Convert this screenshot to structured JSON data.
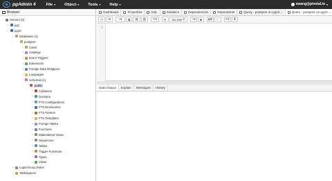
{
  "app": {
    "brand": "pgAdmin 4",
    "user": "swang@pivotal.io"
  },
  "menu": [
    {
      "label": "File"
    },
    {
      "label": "Object"
    },
    {
      "label": "Tools"
    },
    {
      "label": "Help"
    }
  ],
  "browser": {
    "title": "Browser",
    "tree": [
      {
        "label": "Servers (2)",
        "level": 0,
        "toggle": "−",
        "color": "#7a7a7a"
      },
      {
        "label": "pg1",
        "level": 1,
        "toggle": "+",
        "color": "#3a6ea5"
      },
      {
        "label": "pg10",
        "level": 1,
        "toggle": "−",
        "color": "#3a6ea5"
      },
      {
        "label": "Databases (1)",
        "level": 2,
        "toggle": "−",
        "color": "#b5a36a"
      },
      {
        "label": "postgres",
        "level": 3,
        "toggle": "−",
        "color": "#d4a54a"
      },
      {
        "label": "Casts",
        "level": 4,
        "toggle": "+",
        "color": "#c9a044"
      },
      {
        "label": "Catalogs",
        "level": 4,
        "toggle": "+",
        "color": "#a87fc7"
      },
      {
        "label": "Event Triggers",
        "level": 4,
        "toggle": "+",
        "color": "#d08a3a"
      },
      {
        "label": "Extensions",
        "level": 4,
        "toggle": "+",
        "color": "#6aa06a"
      },
      {
        "label": "Foreign Data Wrappers",
        "level": 4,
        "toggle": "+",
        "color": "#5b88c5"
      },
      {
        "label": "Languages",
        "level": 4,
        "toggle": "+",
        "color": "#e0b24a"
      },
      {
        "label": "Schemas (1)",
        "level": 4,
        "toggle": "−",
        "color": "#b07ac0"
      },
      {
        "label": "public",
        "level": 5,
        "toggle": "−",
        "color": "#d05050",
        "selected": true
      },
      {
        "label": "Collations",
        "level": 6,
        "toggle": "+",
        "color": "#b84040"
      },
      {
        "label": "Domains",
        "level": 6,
        "toggle": "+",
        "color": "#4b89c8"
      },
      {
        "label": "FTS Configurations",
        "level": 6,
        "toggle": "+",
        "color": "#5e98c9"
      },
      {
        "label": "FTS Dictionaries",
        "level": 6,
        "toggle": "+",
        "color": "#3f6f9e"
      },
      {
        "label": "FTS Parsers",
        "level": 6,
        "toggle": "+",
        "color": "#c26a2e"
      },
      {
        "label": "FTS Templates",
        "level": 6,
        "toggle": "+",
        "color": "#d8b04a"
      },
      {
        "label": "Foreign Tables",
        "level": 6,
        "toggle": "+",
        "color": "#6f9fcf"
      },
      {
        "label": "Functions",
        "level": 6,
        "toggle": "+",
        "color": "#7b7bb8"
      },
      {
        "label": "Materialized Views",
        "level": 6,
        "toggle": "+",
        "color": "#6c9a5a"
      },
      {
        "label": "Sequences",
        "level": 6,
        "toggle": "+",
        "color": "#8a8a8a"
      },
      {
        "label": "Tables",
        "level": 6,
        "toggle": "+",
        "color": "#5b88c5"
      },
      {
        "label": "Trigger Functions",
        "level": 6,
        "toggle": "+",
        "color": "#c98a3c"
      },
      {
        "label": "Types",
        "level": 6,
        "toggle": "+",
        "color": "#9a6fb0"
      },
      {
        "label": "Views",
        "level": 6,
        "toggle": "+",
        "color": "#5aa06a"
      },
      {
        "label": "Login/Group Roles",
        "level": 2,
        "toggle": "+",
        "color": "#8a8a8a"
      },
      {
        "label": "Tablespaces",
        "level": 2,
        "toggle": "+",
        "color": "#c9a044"
      }
    ]
  },
  "tabs": [
    {
      "label": "Dashboard",
      "icon": "dashboard-icon"
    },
    {
      "label": "Properties",
      "icon": "properties-icon"
    },
    {
      "label": "SQL",
      "icon": "sql-icon"
    },
    {
      "label": "Statistics",
      "icon": "statistics-icon"
    },
    {
      "label": "Dependencies",
      "icon": "dependencies-icon"
    },
    {
      "label": "Dependents",
      "icon": "dependents-icon"
    },
    {
      "label": "Query - postgres on pg10",
      "icon": "query-icon",
      "closable": true
    },
    {
      "label": "Query - postgres on pg10",
      "icon": "query-icon",
      "closable": true,
      "active": true
    }
  ],
  "toolbar": {
    "limit_label": "No limit"
  },
  "editor": {
    "line_number": "1"
  },
  "output_tabs": [
    {
      "label": "Data Output",
      "active": true
    },
    {
      "label": "Explain"
    },
    {
      "label": "Messages"
    },
    {
      "label": "History"
    }
  ]
}
